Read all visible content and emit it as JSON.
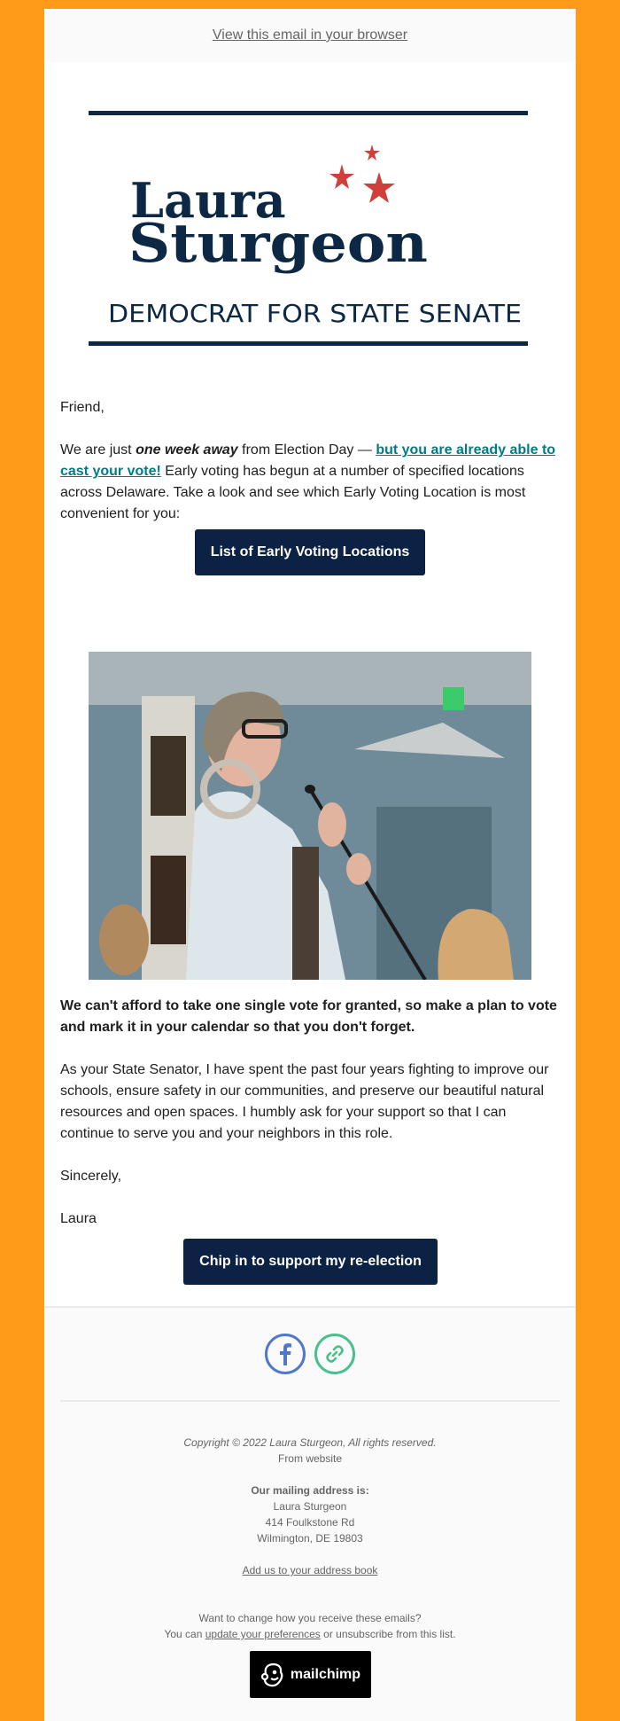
{
  "preheader": {
    "view_in_browser": "View this email in your browser"
  },
  "logo": {
    "first_name": "Laura",
    "last_name": "Sturgeon",
    "tagline": "DEMOCRAT FOR STATE SENATE",
    "navy": "#0C2845",
    "star_red": "#D0403A"
  },
  "body": {
    "greeting": "Friend,",
    "p1_start": "We are just ",
    "p1_emph": "one week away",
    "p1_mid": " from Election Day — ",
    "p1_link": "but you are already able to cast your vote!",
    "p1_end": " Early voting has begun at a number of specified locations across Delaware. Take a look and see which Early Voting Location is most convenient for you:",
    "button1": "List of Early Voting Locations",
    "bold_para": "We can't afford to take one single vote for granted, so make a plan to vote and mark it in your calendar so that you don't forget.",
    "p2": "As your State Senator, I have spent the past four years fighting to improve our schools, ensure safety in our communities, and preserve our beautiful natural resources and open spaces. I humbly ask for your support so that I can continue to serve you and your neighbors in this role.",
    "closing": "Sincerely,",
    "signature": "Laura",
    "button2": "Chip in to support my re-election",
    "photo_alt": "Laura Sturgeon speaking into a microphone in the Senate chamber"
  },
  "footer": {
    "social": [
      {
        "name": "facebook-icon",
        "color": "#4F79C8"
      },
      {
        "name": "link-icon",
        "color": "#48C08C"
      }
    ],
    "copyright": "Copyright © 2022 Laura Sturgeon, All rights reserved.",
    "from": "From website",
    "mailing_label": "Our mailing address is:",
    "address": [
      "Laura Sturgeon",
      "414 Foulkstone Rd",
      "Wilmington, DE 19803"
    ],
    "address_book": "Add us to your address book",
    "change_q": "Want to change how you receive these emails?",
    "change_start": "You can ",
    "update_prefs": "update your preferences",
    "change_end": " or unsubscribe from this list.",
    "badge": "mailchimp"
  },
  "colors": {
    "background": "#FF9B19",
    "button": "#0C2244",
    "link": "#007C89"
  }
}
